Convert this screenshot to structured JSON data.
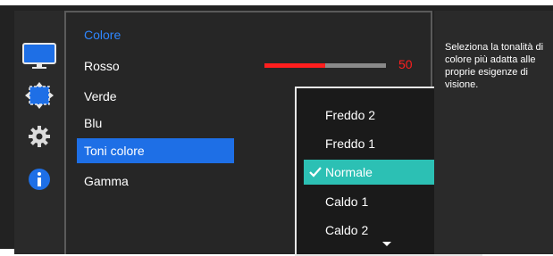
{
  "sidebar": {
    "icons": [
      {
        "name": "picture-icon",
        "color": "#1e6fe6"
      },
      {
        "name": "size-position-icon",
        "color": "#1e6fe6"
      },
      {
        "name": "gear-icon",
        "color": "#dcdcdc"
      },
      {
        "name": "info-icon",
        "color": "#1e6fe6"
      }
    ]
  },
  "menu": {
    "title": "Colore",
    "items": [
      {
        "label": "Rosso"
      },
      {
        "label": "Verde"
      },
      {
        "label": "Blu"
      },
      {
        "label": "Toni colore",
        "selected": true
      },
      {
        "label": "Gamma"
      }
    ],
    "rosso_slider": {
      "value": "50",
      "fill_fraction": 0.5
    }
  },
  "dropdown": {
    "options": [
      {
        "label": "Freddo 2"
      },
      {
        "label": "Freddo 1"
      },
      {
        "label": "Normale",
        "selected": true
      },
      {
        "label": "Caldo 1"
      },
      {
        "label": "Caldo 2"
      }
    ],
    "more_indicator": "chevron-down-icon"
  },
  "description": {
    "text": "Seleziona la tonalità di colore più adatta alle proprie esigenze di visione."
  },
  "colors": {
    "accent_blue": "#1e6fe6",
    "selection_teal": "#2cc0b4",
    "slider_red": "#ff1e1e",
    "panel_dark": "#262626"
  }
}
